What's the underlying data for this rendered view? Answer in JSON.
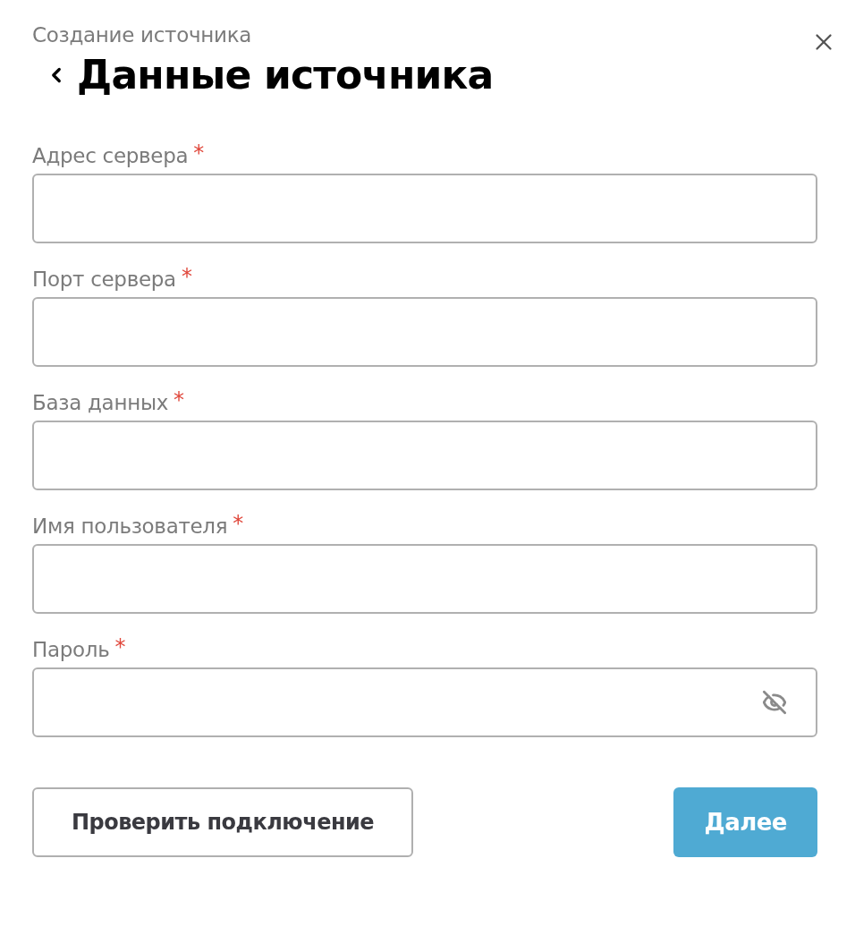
{
  "header": {
    "subtitle": "Создание источника",
    "title": "Данные источника"
  },
  "fields": [
    {
      "label": "Адрес сервера",
      "required_mark": "*",
      "kind": "text"
    },
    {
      "label": "Порт сервера",
      "required_mark": "*",
      "kind": "text"
    },
    {
      "label": "База данных",
      "required_mark": "*",
      "kind": "text"
    },
    {
      "label": "Имя пользователя",
      "required_mark": "*",
      "kind": "text"
    },
    {
      "label": "Пароль",
      "required_mark": "*",
      "kind": "password"
    }
  ],
  "buttons": [
    {
      "label": "Проверить подключение",
      "kind": "secondary"
    },
    {
      "label": "Далее",
      "kind": "primary"
    }
  ]
}
